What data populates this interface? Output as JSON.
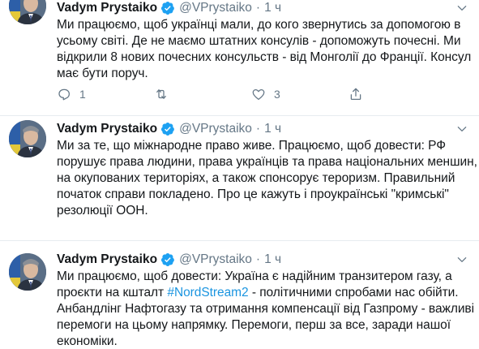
{
  "author": {
    "name": "Vadym Prystaiko",
    "handle": "@VPrystaiko",
    "time": "1 ч"
  },
  "tweets": [
    {
      "lines": [
        "Ми працюємо, щоб українці мали, до кого звернутись за допомогою в",
        "усьому світі. Де не маємо штатних консулів - допоможуть почесні. Ми",
        "відкрили 8 нових почесних консульств - від Монголії до Франції. Консул",
        "має бути поруч."
      ],
      "replies": "1",
      "retweets": "",
      "likes": "3"
    },
    {
      "lines": [
        "Ми за те, що міжнародне право живе. Працюємо, щоб довести: РФ",
        "порушує права людини, права українців та права національних меншин,",
        "на окупованих територіях, а також спонсорує тероризм. Правильний",
        "початок справи покладено. Про це кажуть і проукраїнські \"кримські\"",
        "резолюції ООН."
      ]
    },
    {
      "line1": "Ми працюємо, щоб довести: Україна є надійним транзитером газу, а",
      "line2_pre": "проєкти на кшталт ",
      "hashtag": "#NordStream2",
      "line2_post": " - політичними спробами нас обійти.",
      "line3": "Анбандлінг Нафтогазу та отримання компенсації від Газпрому - важливі",
      "line4": "перемоги на цьому напрямку. Перемоги, перш за все, заради нашої",
      "line5": "економіки."
    }
  ],
  "colors": {
    "text": "#14171a",
    "secondary": "#657786",
    "link": "#1b95e0",
    "verified": "#1da1f2",
    "divider": "#e6ecf0"
  },
  "icons": [
    "avatar-photo",
    "verified-badge-icon",
    "caret-down-icon",
    "reply-icon",
    "retweet-icon",
    "like-icon",
    "share-icon"
  ]
}
